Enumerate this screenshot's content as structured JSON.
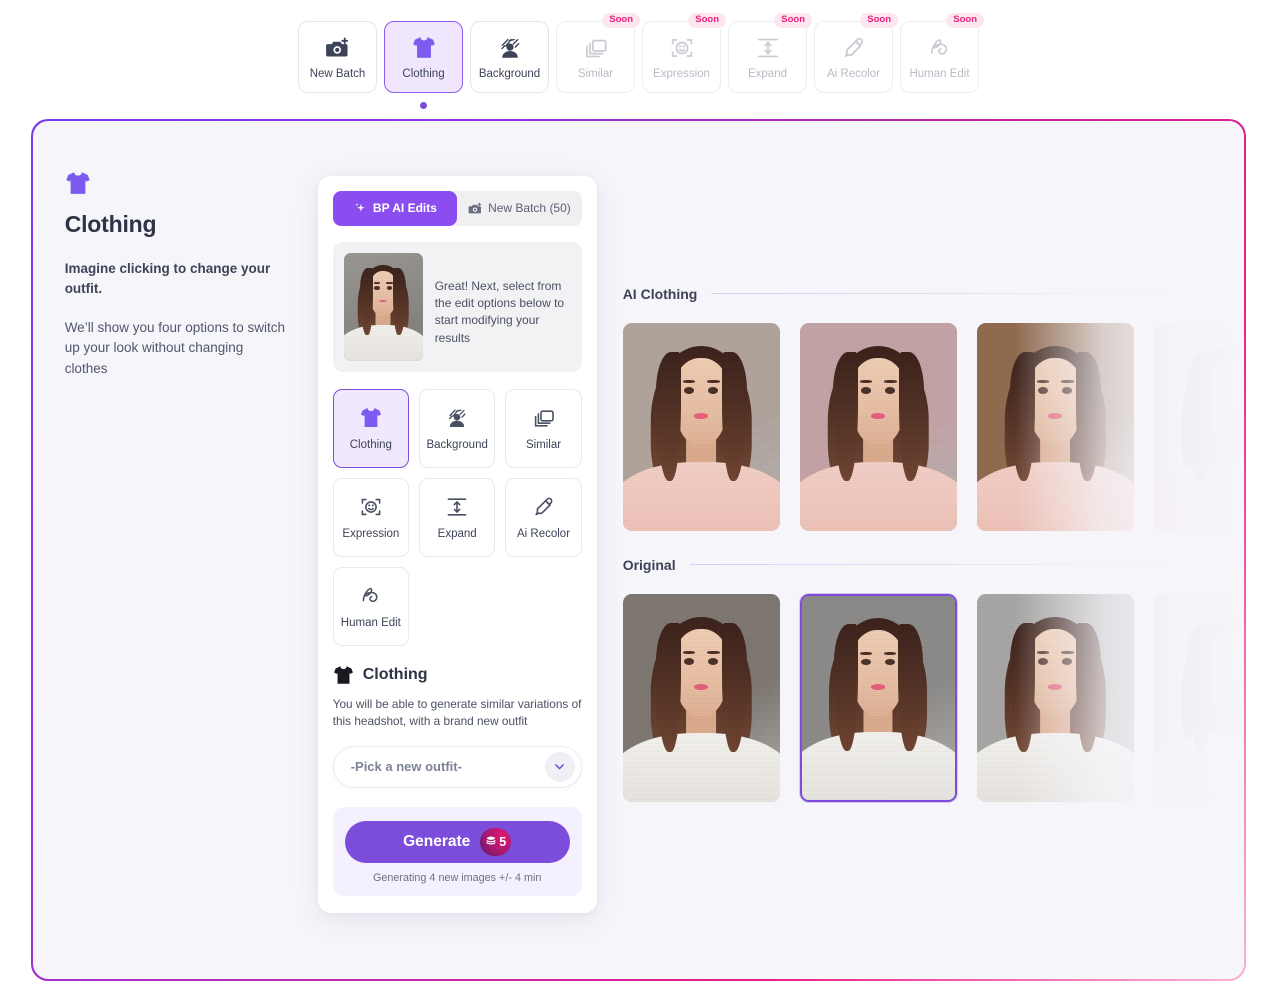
{
  "toolbar": {
    "items": [
      {
        "label": "New Batch",
        "icon": "camera-plus-icon",
        "state": "default",
        "badge": null
      },
      {
        "label": "Clothing",
        "icon": "tshirt-icon",
        "state": "active",
        "badge": null
      },
      {
        "label": "Background",
        "icon": "person-background-icon",
        "state": "default",
        "badge": null
      },
      {
        "label": "Similar",
        "icon": "layers-icon",
        "state": "disabled",
        "badge": "Soon"
      },
      {
        "label": "Expression",
        "icon": "smiley-frame-icon",
        "state": "disabled",
        "badge": "Soon"
      },
      {
        "label": "Expand",
        "icon": "expand-vertical-icon",
        "state": "disabled",
        "badge": "Soon"
      },
      {
        "label": "Ai Recolor",
        "icon": "eyedropper-icon",
        "state": "disabled",
        "badge": "Soon"
      },
      {
        "label": "Human Edit",
        "icon": "squiggle-icon",
        "state": "disabled",
        "badge": "Soon"
      }
    ]
  },
  "info": {
    "icon": "tshirt-icon",
    "title": "Clothing",
    "lead": "Imagine clicking to change your outfit.",
    "body": "We’ll show you four options to switch up your look without changing clothes"
  },
  "panel": {
    "tabs": [
      {
        "label": "BP AI Edits",
        "icon": "sparkle-icon",
        "selected": true
      },
      {
        "label": "New Batch (50)",
        "icon": "camera-plus-icon",
        "selected": false
      }
    ],
    "message": "Great! Next, select from the edit options below to start modifying your results",
    "options": [
      {
        "label": "Clothing",
        "icon": "tshirt-icon",
        "active": true
      },
      {
        "label": "Background",
        "icon": "person-background-icon",
        "active": false
      },
      {
        "label": "Similar",
        "icon": "layers-icon",
        "active": false
      },
      {
        "label": "Expression",
        "icon": "smiley-frame-icon",
        "active": false
      },
      {
        "label": "Expand",
        "icon": "expand-vertical-icon",
        "active": false
      },
      {
        "label": "Ai Recolor",
        "icon": "eyedropper-icon",
        "active": false
      },
      {
        "label": "Human Edit",
        "icon": "squiggle-icon",
        "active": false
      }
    ],
    "section": {
      "icon": "tshirt-solid-icon",
      "title": "Clothing",
      "description": "You will be able to generate similar variations of this headshot, with a brand new outfit",
      "select_value": "-Pick a new outfit-",
      "select_chevron": "chevron-down-icon"
    },
    "generate": {
      "label": "Generate",
      "credits": "5",
      "credit_icon": "coins-icon",
      "note": "Generating 4 new images +/- 4 min"
    }
  },
  "gallery": {
    "sections": [
      {
        "title": "AI Clothing",
        "shots": [
          {
            "name": "ai-clothing-1",
            "bg": "#b0a49c",
            "top": "pink",
            "selected": false
          },
          {
            "name": "ai-clothing-2",
            "bg": "#c4a3a6",
            "top": "pink",
            "selected": false
          },
          {
            "name": "ai-clothing-3",
            "bg": "#8f6a4e",
            "top": "pink",
            "selected": false
          },
          {
            "name": "ai-clothing-4",
            "bg": "#d9d6d4",
            "top": "pink",
            "selected": false
          }
        ]
      },
      {
        "title": "Original",
        "shots": [
          {
            "name": "original-1",
            "bg": "#7d7671",
            "top": "white",
            "selected": false
          },
          {
            "name": "original-2",
            "bg": "#8c8a88",
            "top": "white",
            "selected": true
          },
          {
            "name": "original-3",
            "bg": "#a8a6a4",
            "top": "white",
            "selected": false
          },
          {
            "name": "original-4",
            "bg": "#d6d4d3",
            "top": "white",
            "selected": false
          }
        ]
      }
    ]
  },
  "colors": {
    "accent_purple": "#7c4ddb",
    "tab_purple": "#8b4df0",
    "soon_pink": "#ec1e79",
    "card_bg": "#f6f5fa",
    "border_gradient_start": "#7c3aed",
    "border_gradient_end": "#f9b4d4"
  }
}
